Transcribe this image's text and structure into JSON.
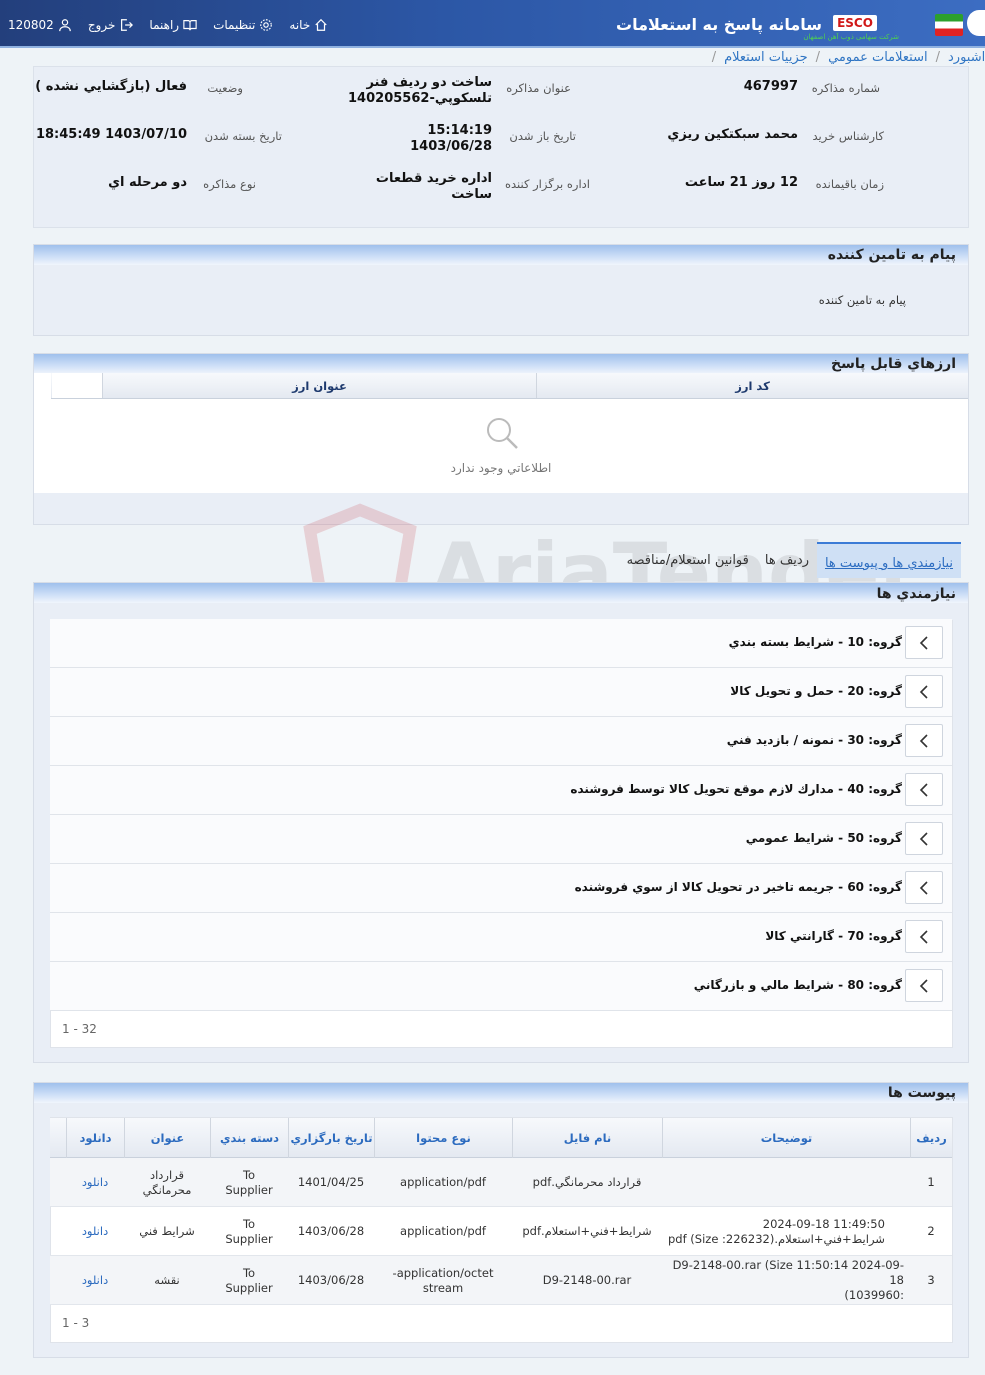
{
  "topbar": {
    "title": "سامانه پاسخ به استعلامات",
    "esco": "ESCO",
    "esco_sub": "شرکت سهامی ذوب آهن اصفهان",
    "nav": {
      "home": "خانه",
      "settings": "تنظيمات",
      "help": "راهنما",
      "logout": "خروج",
      "user_id": "120802"
    }
  },
  "breadcrumb": [
    "داشبورد",
    "استعلامات عمومي",
    "جزييات استعلام"
  ],
  "info": {
    "negotiation_number_label": "شماره مذاکره",
    "negotiation_number": "467997",
    "title_label": "عنوان مذاکره",
    "title_line1": "ساخت دو رديف فنر",
    "title_line2": "تلسکوپي-140205562",
    "status_label": "وضعيت",
    "status": "فعال (بازگشايي نشده )",
    "expert_label": "کارشناس خريد",
    "expert": "محمد سبکتکين ريزي",
    "open_date_label": "تاريخ باز شدن",
    "open_time": "15:14:19",
    "open_date": "1403/06/28",
    "close_date_label": "تاريخ بسته شدن",
    "close_date": "1403/07/10 18:45:49",
    "remaining_label": "زمان باقيمانده",
    "remaining": "12 روز 21 ساعت",
    "office_label": "اداره برگزار کننده",
    "office_line1": "اداره خريد قطعات",
    "office_line2": "ساخت",
    "type_label": "نوع مذاکره",
    "type": "دو مرحله اي"
  },
  "message_panel": {
    "title": "پيام به تامين کننده",
    "body": "پيام به تامين کننده"
  },
  "currency_panel": {
    "title": "ارزهاي قابل پاسخ",
    "columns": [
      "کد ارز",
      "عنوان ارز"
    ],
    "empty": "اطلاعاتي وجود ندارد"
  },
  "tabs": [
    "نيازمندي ها و پيوست ها",
    "رديف ها",
    "قوانين استعلام/مناقصه"
  ],
  "requirements": {
    "title": "نيازمندي ها",
    "groups": [
      "گروه: 10 - شرايط بسته بندي",
      "گروه: 20 - حمل و تحويل کالا",
      "گروه: 30 - نمونه / بازديد فني",
      "گروه: 40 - مدارك لازم موقع تحويل كالا توسط فروشنده",
      "گروه: 50 - شرايط عمومي",
      "گروه: 60 - جريمه تاخير در تحويل کالا از سوي فروشنده",
      "گروه: 70 - گارانتي کالا",
      "گروه: 80 - شرايط مالي و بازرگاني"
    ],
    "pager": "1 - 32"
  },
  "attachments": {
    "title": "پيوست ها",
    "columns": [
      "رديف",
      "توضيحات",
      "نام فايل",
      "نوع محتوا",
      "تاريخ بارگزاري",
      "دسته بندي",
      "عنوان",
      "دانلود"
    ],
    "rows": [
      {
        "idx": "1",
        "desc1": "",
        "desc2": "",
        "file": "قرارداد محرمانگي.pdf",
        "type1": "application/pdf",
        "type2": "",
        "date": "1401/04/25",
        "cat1": "To",
        "cat2": "Supplier",
        "title1": "قرارداد",
        "title2": "محرمانگي",
        "download": "دانلود"
      },
      {
        "idx": "2",
        "desc1": "11:49:50 2024-09-18",
        "desc2": "شرايط+فني+استعلام.pdf (Size :226232)",
        "file": "شرايط+فني+استعلام.pdf",
        "type1": "application/pdf",
        "type2": "",
        "date": "1403/06/28",
        "cat1": "To",
        "cat2": "Supplier",
        "title1": "شرايط فني",
        "title2": "",
        "download": "دانلود"
      },
      {
        "idx": "3",
        "desc1": "D9-2148-00.rar (Size 11:50:14 2024-09-18",
        "desc2": ":1039960)",
        "file": "D9-2148-00.rar",
        "type1": "application/octet-",
        "type2": "stream",
        "date": "1403/06/28",
        "cat1": "To",
        "cat2": "Supplier",
        "title1": "نقشه",
        "title2": "",
        "download": "دانلود"
      }
    ],
    "pager": "1 - 3"
  },
  "colors": {
    "accent": "#3176c4",
    "topbar": "#2c57a6"
  }
}
